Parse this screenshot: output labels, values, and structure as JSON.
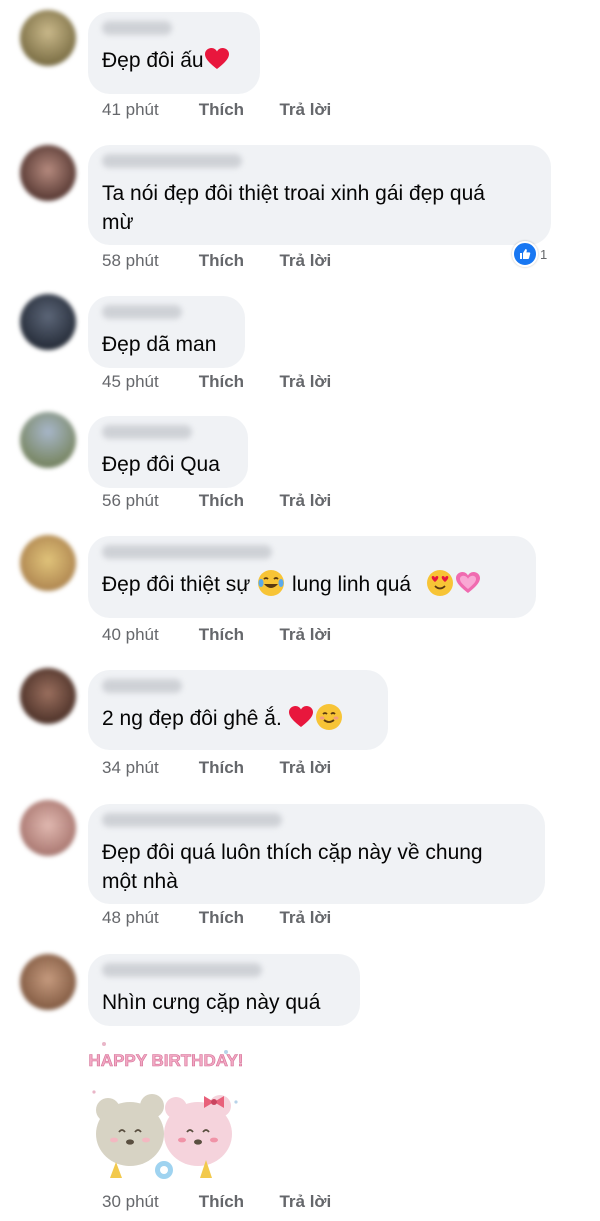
{
  "actions": {
    "like_label": "Thích",
    "reply_label": "Trả lời"
  },
  "comments": [
    {
      "text": "Đẹp đôi ấu",
      "time": "41 phút"
    },
    {
      "text": "Ta nói đẹp đôi thiệt troai xinh gái đẹp quá\nmừ",
      "time": "58 phút",
      "reaction_count": "1",
      "reaction_icon": "like-icon"
    },
    {
      "text": "Đẹp dã man",
      "time": "45 phút"
    },
    {
      "text": "Đẹp đôi Qua",
      "time": "56 phút"
    },
    {
      "text_a": "Đẹp đôi thiệt sự",
      "text_b": "lung linh quá",
      "time": "40 phút"
    },
    {
      "text": "2 ng đẹp đôi ghê ắ.",
      "time": "34 phút"
    },
    {
      "text": "Đẹp đôi quá luôn thích cặp này về chung\nmột nhà",
      "time": "48 phút"
    },
    {
      "text": "Nhìn cưng cặp này quá",
      "time": "30 phút",
      "sticker_text": "HAPPY BIRTHDAY!"
    }
  ],
  "colors": {
    "bubble": "#f0f2f5",
    "meta": "#65676b",
    "like_blue": "#1877f2",
    "heart_red": "#e8173d"
  }
}
